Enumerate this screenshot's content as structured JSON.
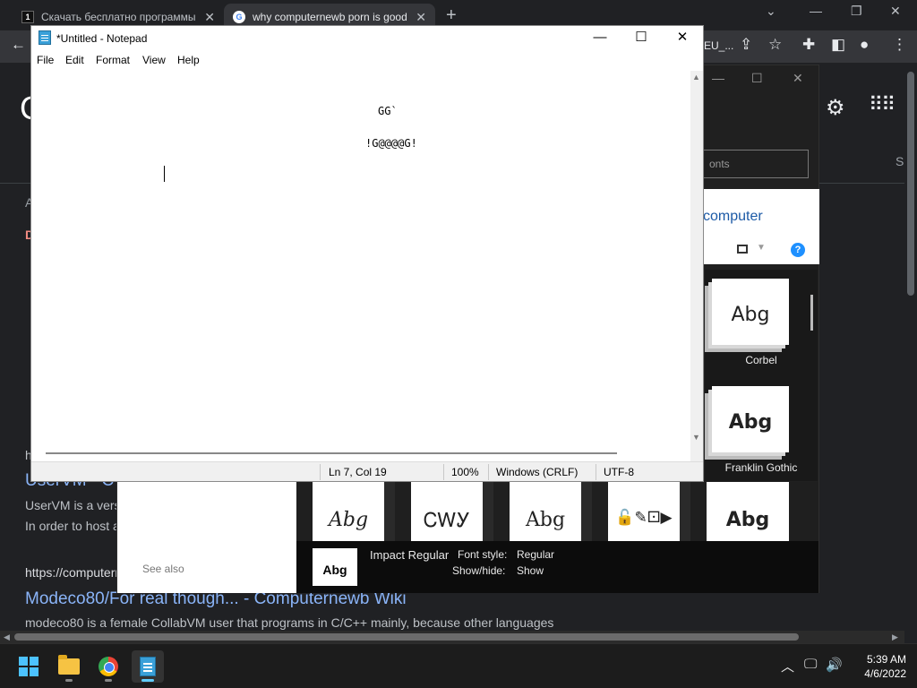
{
  "browser": {
    "tabs": [
      {
        "title": "Скачать бесплатно программы"
      },
      {
        "title": "why computernewb porn is good"
      }
    ],
    "new_tab_symbol": "+",
    "url_fragment": "EU_...",
    "page": {
      "logo_letter": "G",
      "letter_a": "A",
      "letter_d": "D",
      "letter_s": "S",
      "letter_h": "h",
      "result1_title": "UserVM - C",
      "result1_snippet_1": "UserVM is a vers",
      "result1_snippet_2": "In order to host a",
      "result2_url": "https://computern",
      "result2_title": "Modeco80/For real though... - Computernewb Wiki",
      "result2_snippet": "modeco80 is a female CollabVM user that programs in C/C++ mainly, because other languages"
    }
  },
  "fonts_window": {
    "search_placeholder": "onts",
    "header_title": "computer",
    "help_symbol": "?",
    "see_also": "See also",
    "tiles": [
      {
        "sample": "Abg",
        "label": "Corbel"
      },
      {
        "sample": "Abg",
        "label": "Franklin Gothic"
      }
    ],
    "row_tiles": [
      "Abg",
      "ᏟᎳᎩ",
      "Abg",
      "🔓✎⚀▶",
      "Abg"
    ],
    "details": {
      "thumb": "Abg",
      "name": "Impact Regular",
      "font_style_label": "Font style:",
      "font_style_value": "Regular",
      "show_hide_label": "Show/hide:",
      "show_hide_value": "Show"
    }
  },
  "notepad": {
    "title": "*Untitled - Notepad",
    "menu": [
      "File",
      "Edit",
      "Format",
      "View",
      "Help"
    ],
    "lines": [
      "GG`",
      "!G@@@@G!"
    ],
    "status": {
      "position": "Ln 7, Col 19",
      "zoom": "100%",
      "line_ending": "Windows (CRLF)",
      "encoding": "UTF-8"
    }
  },
  "taskbar": {
    "time": "5:39 AM",
    "date": "4/6/2022"
  },
  "colors": {
    "accent_blue": "#60cdff",
    "link_blue": "#8ab4f8",
    "chrome_dark": "#202124"
  }
}
